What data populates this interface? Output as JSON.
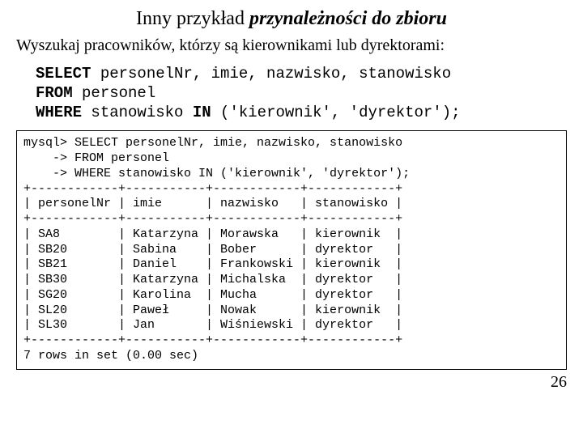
{
  "title": {
    "plain": "Inny przykład ",
    "emph": "przynależności do zbioru"
  },
  "subtitle": "Wyszukaj pracowników, którzy są kierownikami lub dyrektorami:",
  "query": {
    "kw_select": "SELECT",
    "select_cols": " personelNr, imie, nazwisko, stanowisko",
    "kw_from": "FROM",
    "from_table": " personel",
    "kw_where": "WHERE",
    "where_col": " stanowisko ",
    "kw_in": "IN",
    "in_list": " ('kierownik', 'dyrektor');"
  },
  "result": {
    "prompt_line1": "mysql> SELECT personelNr, imie, nazwisko, stanowisko",
    "prompt_line2": "    -> FROM personel",
    "prompt_line3": "    -> WHERE stanowisko IN ('kierownik', 'dyrektor');",
    "sep": "+------------+-----------+------------+------------+",
    "header": "| personelNr | imie      | nazwisko   | stanowisko |",
    "rows": [
      "| SA8        | Katarzyna | Morawska   | kierownik  |",
      "| SB20       | Sabina    | Bober      | dyrektor   |",
      "| SB21       | Daniel    | Frankowski | kierownik  |",
      "| SB30       | Katarzyna | Michalska  | dyrektor   |",
      "| SG20       | Karolina  | Mucha      | dyrektor   |",
      "| SL20       | Paweł     | Nowak      | kierownik  |",
      "| SL30       | Jan       | Wiśniewski | dyrektor   |"
    ],
    "footer": "7 rows in set (0.00 sec)"
  },
  "page_number": "26"
}
